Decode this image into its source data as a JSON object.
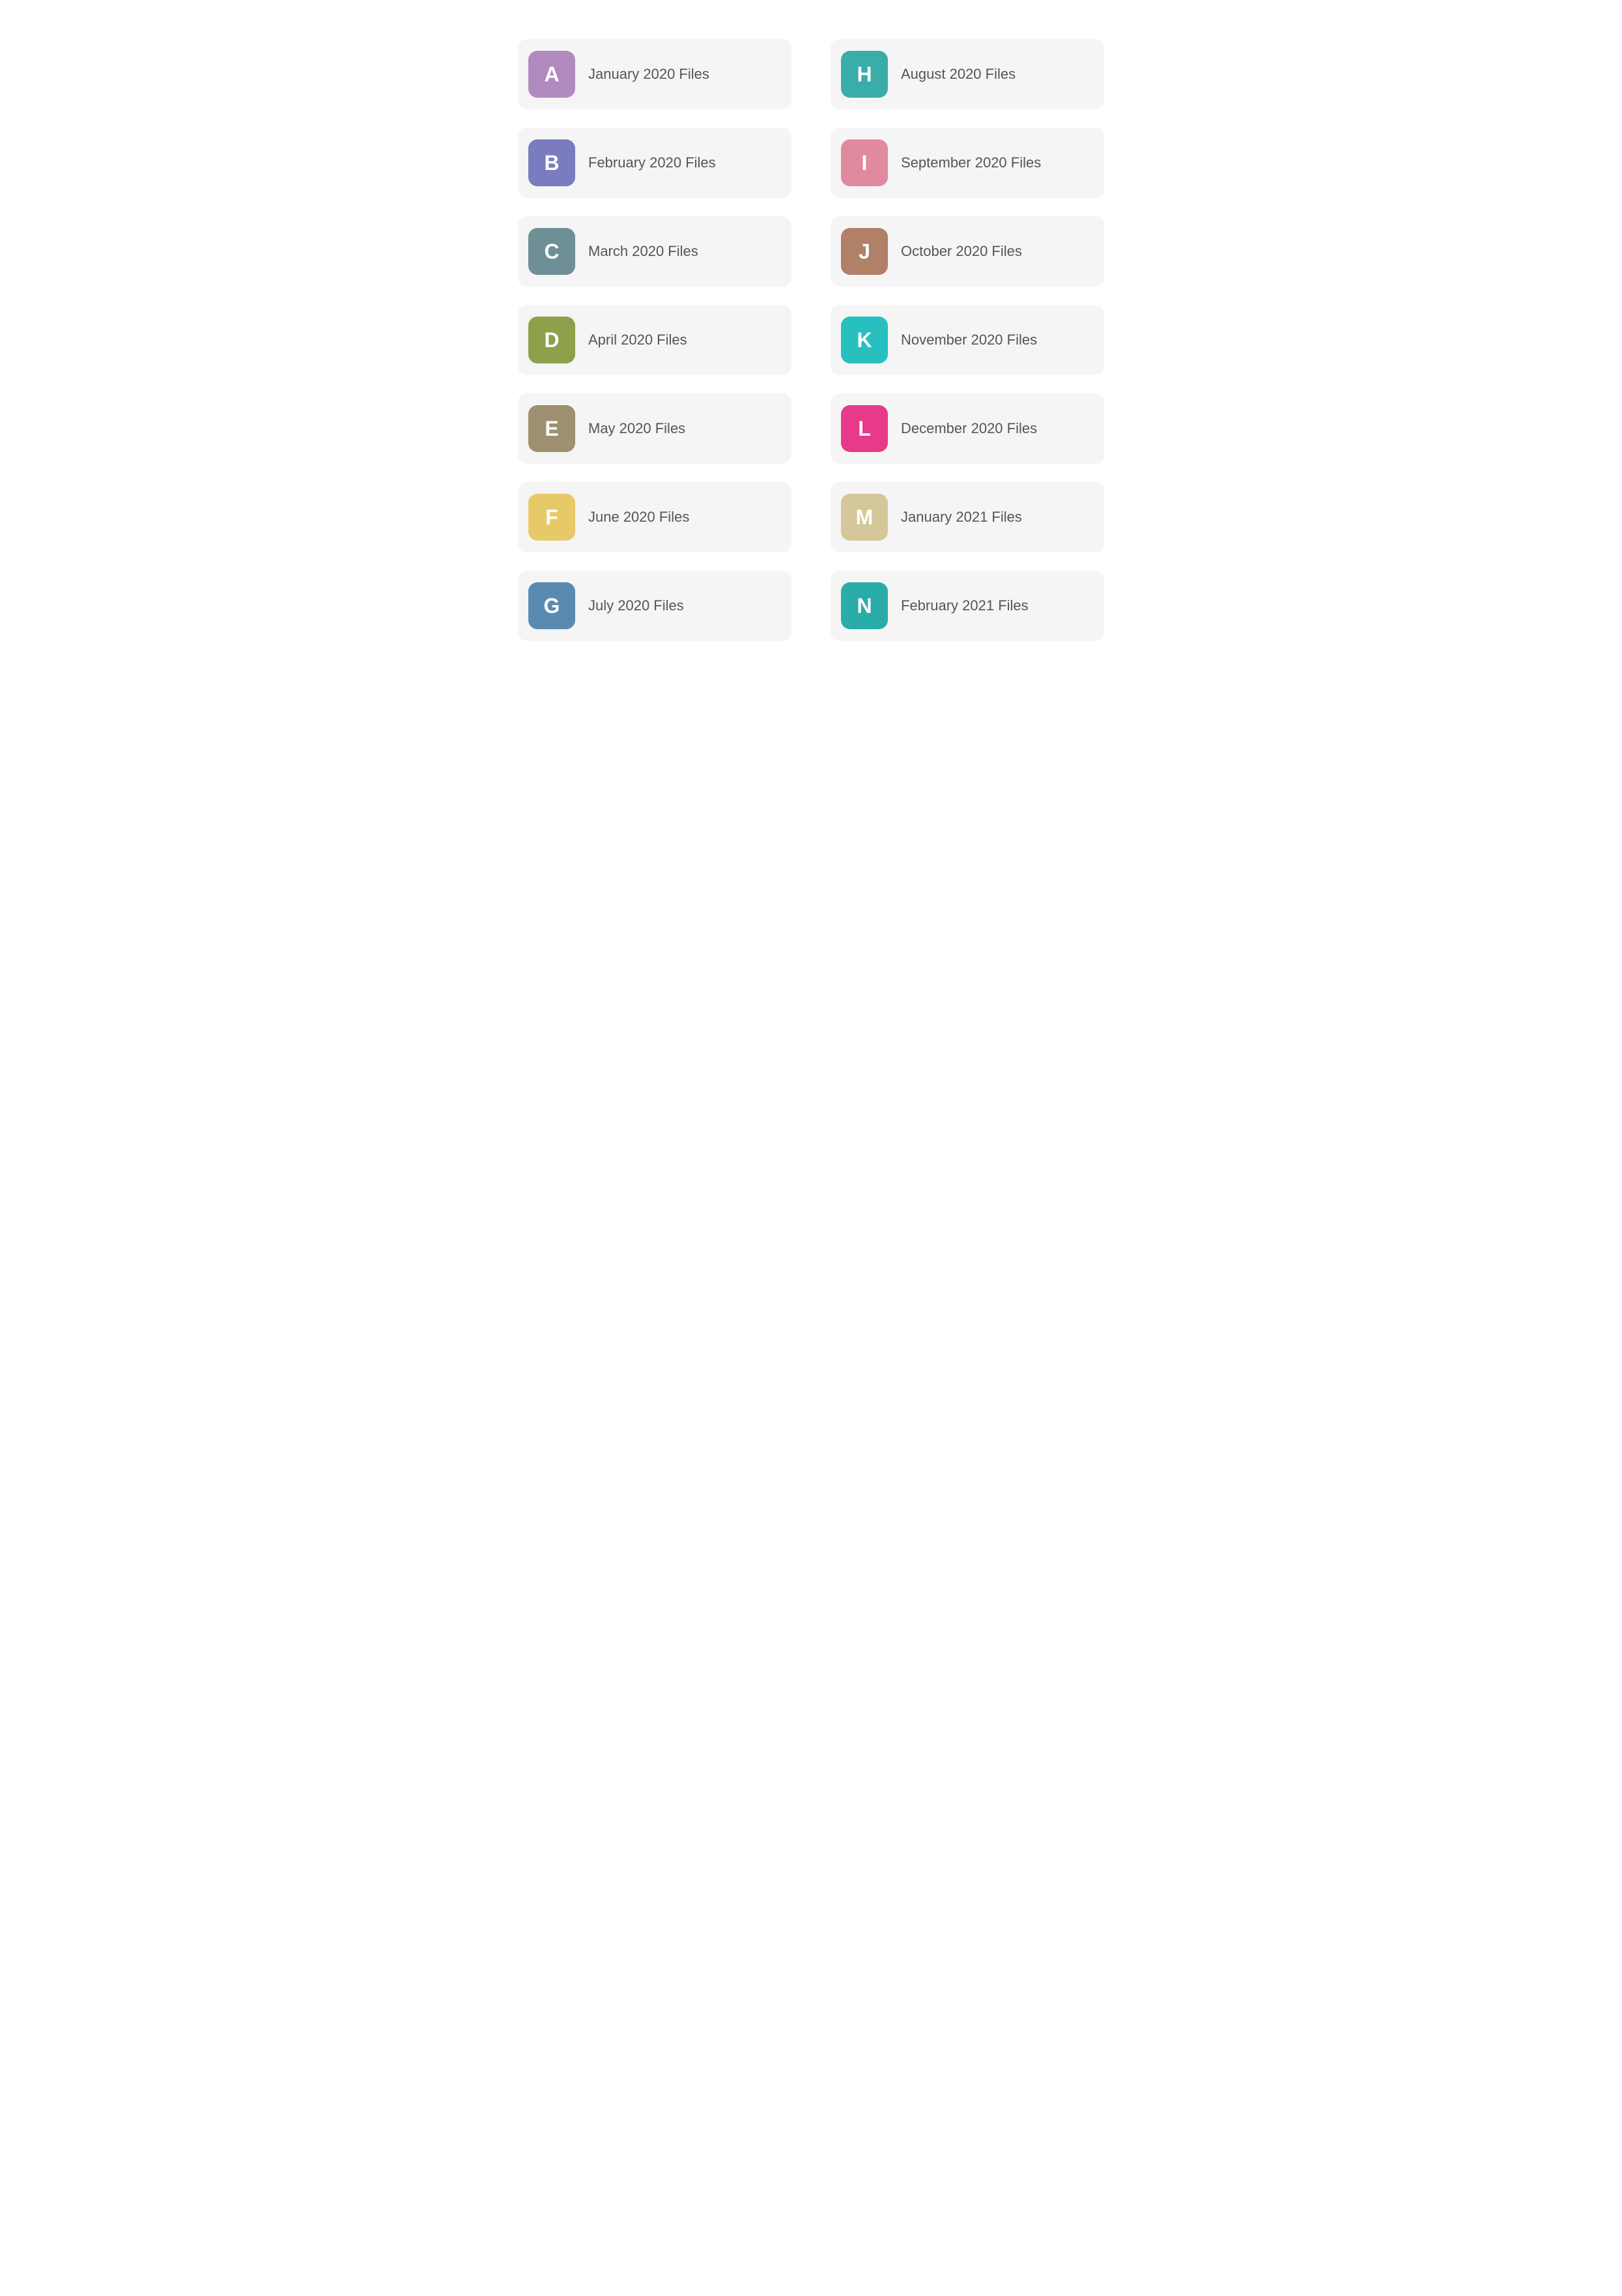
{
  "items": [
    {
      "id": "a",
      "letter": "A",
      "label": "January 2020 Files",
      "colorClass": "color-a"
    },
    {
      "id": "h",
      "letter": "H",
      "label": "August 2020 Files",
      "colorClass": "color-h"
    },
    {
      "id": "b",
      "letter": "B",
      "label": "February 2020 Files",
      "colorClass": "color-b"
    },
    {
      "id": "i",
      "letter": "I",
      "label": "September 2020 Files",
      "colorClass": "color-i"
    },
    {
      "id": "c",
      "letter": "C",
      "label": "March 2020 Files",
      "colorClass": "color-c"
    },
    {
      "id": "j",
      "letter": "J",
      "label": "October 2020 Files",
      "colorClass": "color-j"
    },
    {
      "id": "d",
      "letter": "D",
      "label": "April 2020 Files",
      "colorClass": "color-d"
    },
    {
      "id": "k",
      "letter": "K",
      "label": "November 2020 Files",
      "colorClass": "color-k"
    },
    {
      "id": "e",
      "letter": "E",
      "label": "May 2020 Files",
      "colorClass": "color-e"
    },
    {
      "id": "l",
      "letter": "L",
      "label": "December 2020 Files",
      "colorClass": "color-l"
    },
    {
      "id": "f",
      "letter": "F",
      "label": "June 2020 Files",
      "colorClass": "color-f"
    },
    {
      "id": "m",
      "letter": "M",
      "label": "January 2021 Files",
      "colorClass": "color-m"
    },
    {
      "id": "g",
      "letter": "G",
      "label": "July 2020 Files",
      "colorClass": "color-g"
    },
    {
      "id": "n",
      "letter": "N",
      "label": "February 2021 Files",
      "colorClass": "color-n"
    }
  ]
}
